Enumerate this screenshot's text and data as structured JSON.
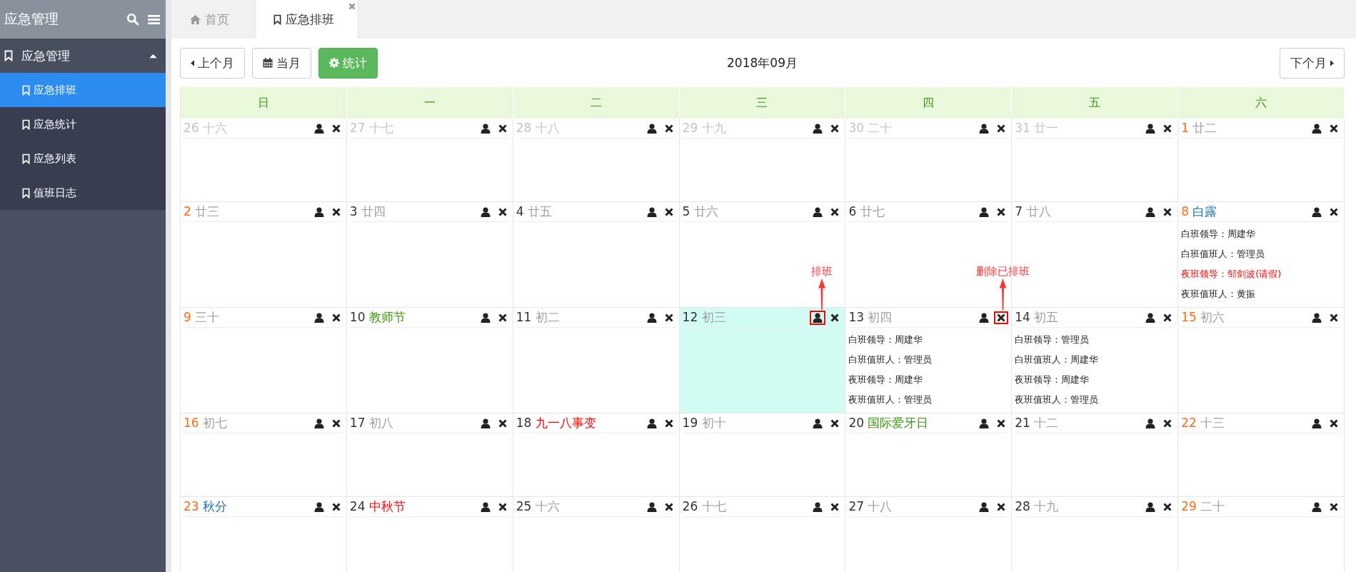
{
  "sidebar": {
    "title": "应急管理",
    "group": {
      "label": "应急管理",
      "expanded": true
    },
    "items": [
      {
        "label": "应急排班",
        "selected": true
      },
      {
        "label": "应急统计",
        "selected": false
      },
      {
        "label": "应急列表",
        "selected": false
      },
      {
        "label": "值班日志",
        "selected": false
      }
    ]
  },
  "tabs": [
    {
      "label": "首页",
      "kind": "home",
      "selected": false,
      "closable": false
    },
    {
      "label": "应急排班",
      "kind": "page",
      "selected": true,
      "closable": true
    }
  ],
  "toolbar": {
    "prev": "上个月",
    "current": "当月",
    "stats": "统计",
    "title": "2018年09月",
    "next": "下个月"
  },
  "weekdays": [
    "日",
    "一",
    "二",
    "三",
    "四",
    "五",
    "六"
  ],
  "weeks": [
    [
      {
        "date": {
          "text": "26",
          "kind": "outside"
        },
        "label": {
          "text": "十六",
          "kind": "lunar"
        },
        "selected": false
      },
      {
        "date": {
          "text": "27",
          "kind": "outside"
        },
        "label": {
          "text": "十七",
          "kind": "lunar"
        },
        "selected": false
      },
      {
        "date": {
          "text": "28",
          "kind": "outside"
        },
        "label": {
          "text": "十八",
          "kind": "lunar"
        },
        "selected": false
      },
      {
        "date": {
          "text": "29",
          "kind": "outside"
        },
        "label": {
          "text": "十九",
          "kind": "lunar"
        },
        "selected": false
      },
      {
        "date": {
          "text": "30",
          "kind": "outside"
        },
        "label": {
          "text": "二十",
          "kind": "lunar"
        },
        "selected": false
      },
      {
        "date": {
          "text": "31",
          "kind": "outside"
        },
        "label": {
          "text": "廿一",
          "kind": "lunar"
        },
        "selected": false
      },
      {
        "date": {
          "text": "1",
          "kind": "weekend"
        },
        "label": {
          "text": "廿二",
          "kind": "lunar"
        },
        "selected": false
      }
    ],
    [
      {
        "date": {
          "text": "2",
          "kind": "weekend"
        },
        "label": {
          "text": "廿三",
          "kind": "lunar"
        },
        "selected": false
      },
      {
        "date": {
          "text": "3",
          "kind": "weekday"
        },
        "label": {
          "text": "廿四",
          "kind": "lunar"
        },
        "selected": false
      },
      {
        "date": {
          "text": "4",
          "kind": "weekday"
        },
        "label": {
          "text": "廿五",
          "kind": "lunar"
        },
        "selected": false
      },
      {
        "date": {
          "text": "5",
          "kind": "weekday"
        },
        "label": {
          "text": "廿六",
          "kind": "lunar"
        },
        "selected": false
      },
      {
        "date": {
          "text": "6",
          "kind": "weekday"
        },
        "label": {
          "text": "廿七",
          "kind": "lunar"
        },
        "selected": false
      },
      {
        "date": {
          "text": "7",
          "kind": "weekday"
        },
        "label": {
          "text": "廿八",
          "kind": "lunar"
        },
        "selected": false
      },
      {
        "date": {
          "text": "8",
          "kind": "weekend"
        },
        "label": {
          "text": "白露",
          "kind": "term"
        },
        "selected": false,
        "duties": [
          {
            "text": "白班领导：周建华",
            "alert": false
          },
          {
            "text": "白班值班人：管理员",
            "alert": false
          },
          {
            "text": "夜班领导：邹剑波(请假)",
            "alert": true
          },
          {
            "text": "夜班值班人：黄振",
            "alert": false
          }
        ]
      }
    ],
    [
      {
        "date": {
          "text": "9",
          "kind": "weekend"
        },
        "label": {
          "text": "三十",
          "kind": "lunar"
        },
        "selected": false
      },
      {
        "date": {
          "text": "10",
          "kind": "weekday"
        },
        "label": {
          "text": "教师节",
          "kind": "observance"
        },
        "selected": false
      },
      {
        "date": {
          "text": "11",
          "kind": "weekday"
        },
        "label": {
          "text": "初二",
          "kind": "lunar"
        },
        "selected": false
      },
      {
        "date": {
          "text": "12",
          "kind": "weekday"
        },
        "label": {
          "text": "初三",
          "kind": "lunar"
        },
        "selected": true,
        "annotation": {
          "kind": "assign",
          "label": "排班"
        }
      },
      {
        "date": {
          "text": "13",
          "kind": "weekday"
        },
        "label": {
          "text": "初四",
          "kind": "lunar"
        },
        "selected": false,
        "annotation": {
          "kind": "delete",
          "label": "删除已排班"
        },
        "duties": [
          {
            "text": "白班领导：周建华",
            "alert": false
          },
          {
            "text": "白班值班人：管理员",
            "alert": false
          },
          {
            "text": "夜班领导：周建华",
            "alert": false
          },
          {
            "text": "夜班值班人：管理员",
            "alert": false
          }
        ]
      },
      {
        "date": {
          "text": "14",
          "kind": "weekday"
        },
        "label": {
          "text": "初五",
          "kind": "lunar"
        },
        "selected": false,
        "duties": [
          {
            "text": "白班领导：管理员",
            "alert": false
          },
          {
            "text": "白班值班人：周建华",
            "alert": false
          },
          {
            "text": "夜班领导：周建华",
            "alert": false
          },
          {
            "text": "夜班值班人：管理员",
            "alert": false
          }
        ]
      },
      {
        "date": {
          "text": "15",
          "kind": "weekend"
        },
        "label": {
          "text": "初六",
          "kind": "lunar"
        },
        "selected": false
      }
    ],
    [
      {
        "date": {
          "text": "16",
          "kind": "weekend"
        },
        "label": {
          "text": "初七",
          "kind": "lunar"
        },
        "selected": false
      },
      {
        "date": {
          "text": "17",
          "kind": "weekday"
        },
        "label": {
          "text": "初八",
          "kind": "lunar"
        },
        "selected": false
      },
      {
        "date": {
          "text": "18",
          "kind": "weekday"
        },
        "label": {
          "text": "九一八事变",
          "kind": "holiday"
        },
        "selected": false
      },
      {
        "date": {
          "text": "19",
          "kind": "weekday"
        },
        "label": {
          "text": "初十",
          "kind": "lunar"
        },
        "selected": false
      },
      {
        "date": {
          "text": "20",
          "kind": "weekday"
        },
        "label": {
          "text": "国际爱牙日",
          "kind": "observance"
        },
        "selected": false
      },
      {
        "date": {
          "text": "21",
          "kind": "weekday"
        },
        "label": {
          "text": "十二",
          "kind": "lunar"
        },
        "selected": false
      },
      {
        "date": {
          "text": "22",
          "kind": "weekend"
        },
        "label": {
          "text": "十三",
          "kind": "lunar"
        },
        "selected": false
      }
    ],
    [
      {
        "date": {
          "text": "23",
          "kind": "weekend"
        },
        "label": {
          "text": "秋分",
          "kind": "term"
        },
        "selected": false
      },
      {
        "date": {
          "text": "24",
          "kind": "weekday"
        },
        "label": {
          "text": "中秋节",
          "kind": "holiday"
        },
        "selected": false
      },
      {
        "date": {
          "text": "25",
          "kind": "weekday"
        },
        "label": {
          "text": "十六",
          "kind": "lunar"
        },
        "selected": false
      },
      {
        "date": {
          "text": "26",
          "kind": "weekday"
        },
        "label": {
          "text": "十七",
          "kind": "lunar"
        },
        "selected": false
      },
      {
        "date": {
          "text": "27",
          "kind": "weekday"
        },
        "label": {
          "text": "十八",
          "kind": "lunar"
        },
        "selected": false
      },
      {
        "date": {
          "text": "28",
          "kind": "weekday"
        },
        "label": {
          "text": "十九",
          "kind": "lunar"
        },
        "selected": false
      },
      {
        "date": {
          "text": "29",
          "kind": "weekend"
        },
        "label": {
          "text": "二十",
          "kind": "lunar"
        },
        "selected": false
      }
    ]
  ]
}
